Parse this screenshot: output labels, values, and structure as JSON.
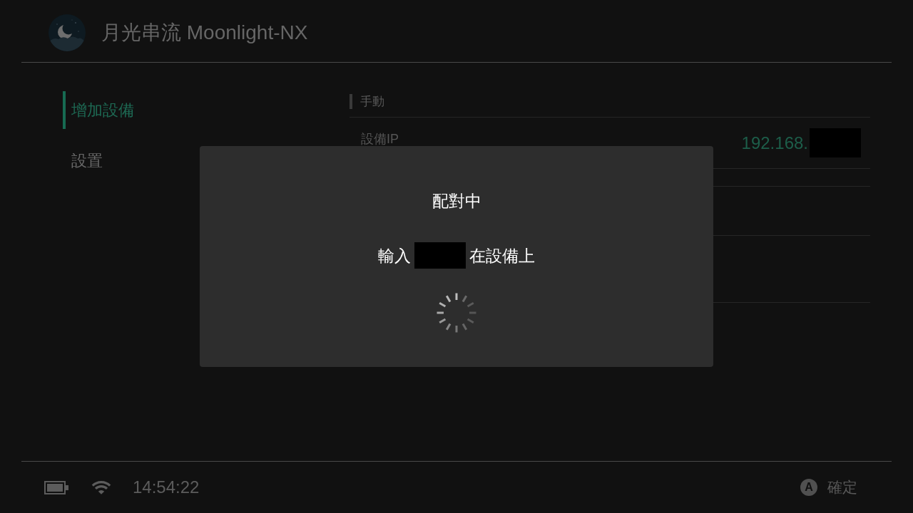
{
  "header": {
    "title": "月光串流 Moonlight-NX"
  },
  "sidebar": {
    "items": [
      {
        "label": "增加設備",
        "selected": true
      },
      {
        "label": "設置",
        "selected": false
      }
    ]
  },
  "content": {
    "section": "手動",
    "rows": [
      {
        "label": "設備IP",
        "value": "192.168."
      }
    ]
  },
  "dialog": {
    "title": "配對中",
    "message_start": "輸入",
    "message_end": "在設備上"
  },
  "status_bar": {
    "time": "14:54:22"
  },
  "footer_actions": [
    {
      "key": "A",
      "label": "確定"
    }
  ]
}
